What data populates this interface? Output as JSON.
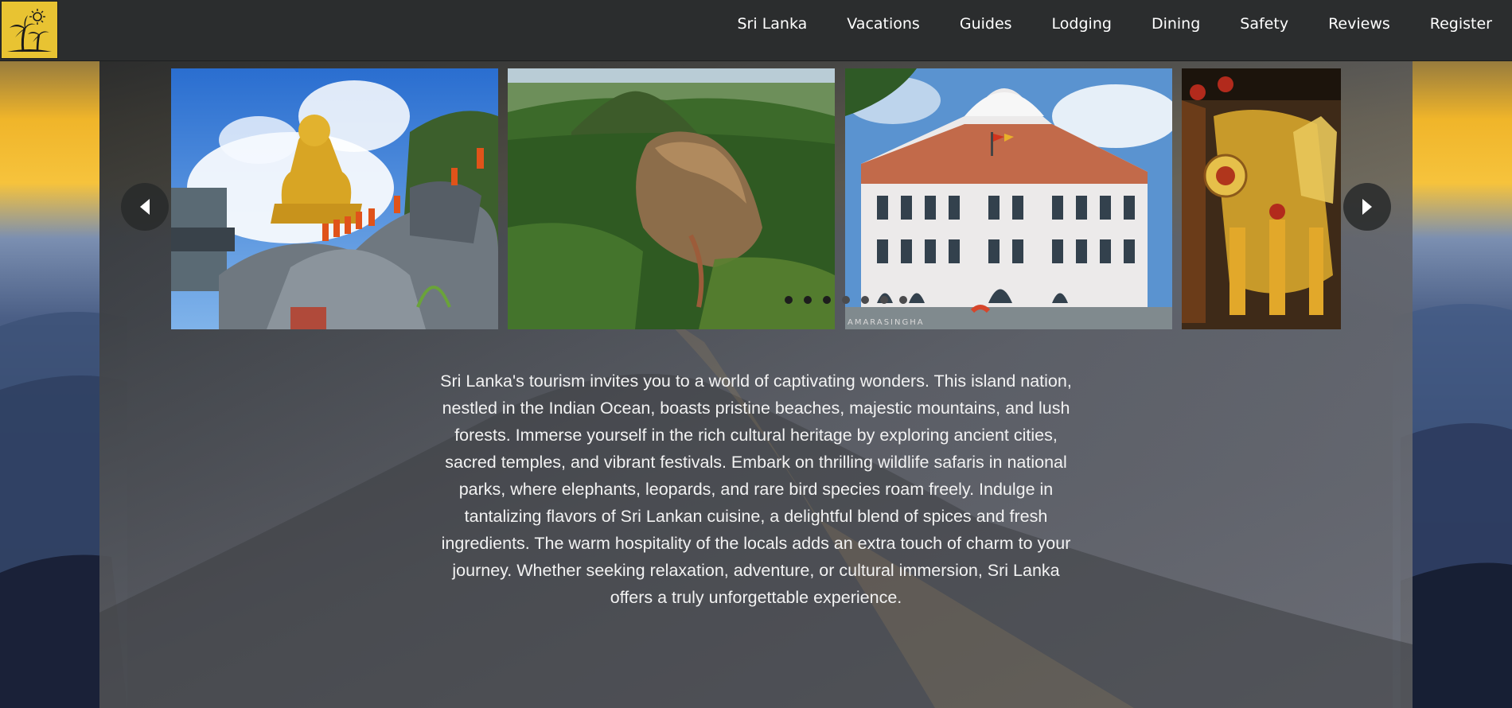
{
  "nav": {
    "logo_icon": "palm-trees-logo",
    "links": [
      "Sri Lanka",
      "Vacations",
      "Guides",
      "Lodging",
      "Dining",
      "Safety",
      "Reviews",
      "Register"
    ]
  },
  "carousel": {
    "slides": [
      {
        "icon": "golden-buddha-temple-photo"
      },
      {
        "icon": "sigiriya-rock-photo"
      },
      {
        "icon": "colonial-hotel-photo",
        "watermark": "AMARASINGHA"
      },
      {
        "icon": "perahera-elephant-photo"
      }
    ],
    "prev_icon": "chevron-left-icon",
    "next_icon": "chevron-right-icon",
    "dots": {
      "count": 7,
      "active": [
        0,
        1,
        2
      ]
    }
  },
  "description": "Sri Lanka's tourism invites you to a world of captivating wonders. This island nation, nestled in the Indian Ocean, boasts pristine beaches, majestic mountains, and lush forests. Immerse yourself in the rich cultural heritage by exploring ancient cities, sacred temples, and vibrant festivals. Embark on thrilling wildlife safaris in national parks, where elephants, leopards, and rare bird species roam freely. Indulge in tantalizing flavors of Sri Lankan cuisine, a delightful blend of spices and fresh ingredients. The warm hospitality of the locals adds an extra touch of charm to your journey. Whether seeking relaxation, adventure, or cultural immersion, Sri Lanka offers a truly unforgettable experience.",
  "colors": {
    "logo_bg": "#e8c332",
    "nav_bg": "#2b2d2e",
    "dot_active": "#1d1d1d",
    "dot_inactive": "#4b4b4d"
  }
}
